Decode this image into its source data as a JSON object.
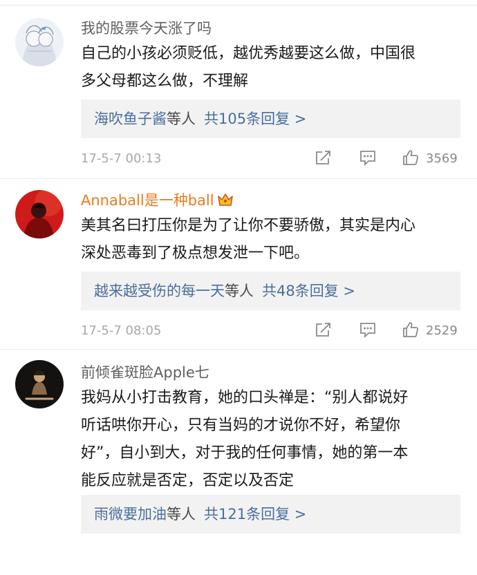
{
  "comments": [
    {
      "username": "我的股票今天涨了吗",
      "content_lines": [
        "自己的小孩必须贬低，越优秀越要这么做，中国很",
        "多父母都这么做，不理解"
      ],
      "replies": {
        "names": "海吹鱼子酱",
        "suffix": "等人",
        "count": "共105条回复 >"
      },
      "timestamp": "17-5-7 00:13",
      "likes": "3569"
    },
    {
      "username": "Annaball是一种ball",
      "content_lines": [
        "美其名曰打压你是为了让你不要骄傲，其实是内心",
        "深处恶毒到了极点想发泄一下吧。"
      ],
      "replies": {
        "names": "越来越受伤的每一天",
        "suffix": "等人",
        "count": "共48条回复 >"
      },
      "timestamp": "17-5-7 08:05",
      "likes": "2529",
      "badge_icon": "crown-icon"
    },
    {
      "username": "前倾雀斑脸Apple七",
      "content_lines": [
        "我妈从小打击教育，她的口头禅是：“别人都说好",
        "听话哄你开心，只有当妈的才说你不好，希望你",
        "好”，自小到大，对于我的任何事情，她的第一本",
        "能反应就是否定，否定以及否定"
      ],
      "replies": {
        "names": "雨微要加油",
        "suffix": "等人",
        "count": "共121条回复 >"
      }
    }
  ],
  "action_icons": [
    "share-icon",
    "comment-icon",
    "like-icon"
  ],
  "colors": {
    "link": "#4a6e9c",
    "vip_name": "#ea7b1e",
    "reply_bg": "#f2f2f2",
    "timestamp": "#a8a8a8"
  }
}
